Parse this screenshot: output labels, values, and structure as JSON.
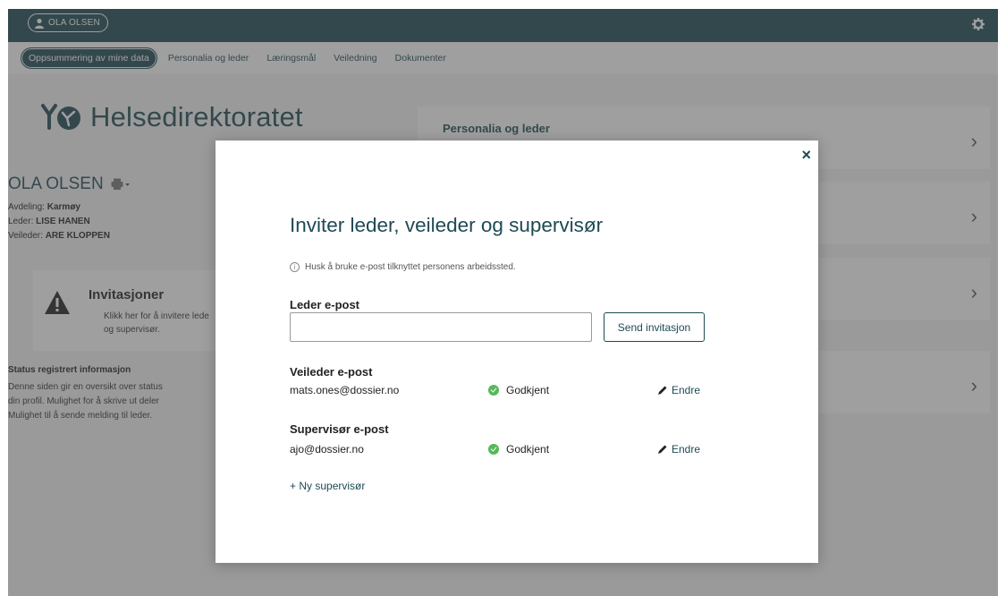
{
  "topbar": {
    "user_name": "OLA OLSEN",
    "user_icon": "user-icon",
    "settings_icon": "gear-icon"
  },
  "nav": {
    "items": [
      {
        "label": "Oppsummering av mine data",
        "active": true
      },
      {
        "label": "Personalia og leder",
        "active": false
      },
      {
        "label": "Læringsmål",
        "active": false
      },
      {
        "label": "Veiledning",
        "active": false
      },
      {
        "label": "Dokumenter",
        "active": false
      }
    ]
  },
  "page": {
    "logo_text": "Helsedirektoratet",
    "person_name": "OLA OLSEN",
    "print_icon": "printer-icon",
    "meta": {
      "avdeling_label": "Avdeling:",
      "avdeling_value": "Karmøy",
      "leder_label": "Leder:",
      "leder_value": "LISE HANEN",
      "veileder_label": "Veileder:",
      "veileder_value": "ARE KLOPPEN"
    },
    "invite_card": {
      "title": "Invitasjoner",
      "desc_line1": "Klikk her for å invitere lede",
      "desc_line2": "og supervisør."
    },
    "status_title": "Status registrert informasjon",
    "status_desc": [
      "Denne siden gir en oversikt over status",
      "din profil. Mulighet for å skrive ut deler",
      "Mulighet til å sende melding til leder."
    ],
    "right_cards": [
      {
        "title": "Personalia og leder"
      },
      {
        "title": ""
      },
      {
        "title": ""
      },
      {
        "title": ""
      }
    ]
  },
  "modal": {
    "close_label": "×",
    "title": "Inviter leder, veileder og supervisør",
    "hint": "Husk å bruke e-post tilknyttet personens arbeidssted.",
    "leder_label": "Leder e-post",
    "leder_input_value": "",
    "send_button": "Send invitasjon",
    "veileder_label": "Veileder e-post",
    "veileder_email": "mats.ones@dossier.no",
    "veileder_status": "Godkjent",
    "supervisor_label": "Supervisør e-post",
    "supervisor_email": "ajo@dossier.no",
    "supervisor_status": "Godkjent",
    "edit_label": "Endre",
    "new_supervisor": "+ Ny supervisør"
  },
  "colors": {
    "brand": "#1e4a55",
    "success": "#55b95a",
    "background": "#f5f5f5"
  }
}
